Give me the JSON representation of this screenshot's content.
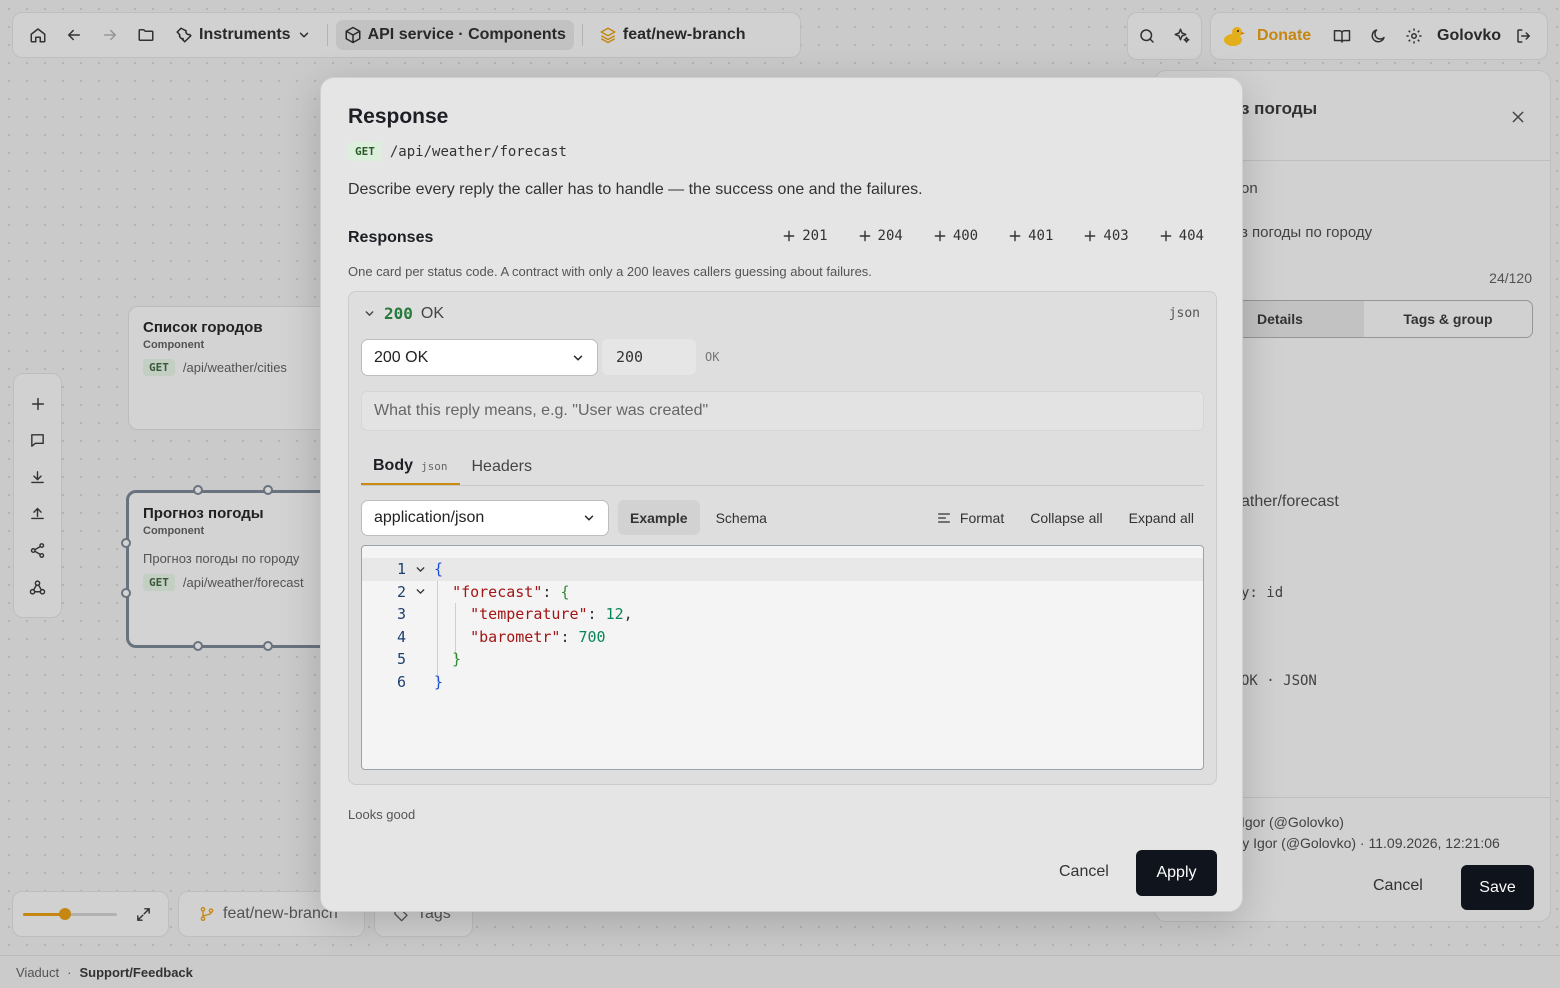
{
  "topbar": {
    "instruments_label": "Instruments",
    "project_label": "API service · Components",
    "branch_label": "feat/new-branch"
  },
  "userbar": {
    "donate_label": "Donate",
    "username": "Golovko"
  },
  "canvas": {
    "node_cities": {
      "title": "Список городов",
      "kind": "Component",
      "method": "GET",
      "path": "/api/weather/cities"
    },
    "node_forecast": {
      "title": "Прогноз погоды",
      "kind": "Component",
      "description": "Прогноз погоды по городу",
      "method": "GET",
      "path": "/api/weather/forecast"
    }
  },
  "bottombar": {
    "zoom_fraction": 0.45,
    "branch_label": "feat/new-branch",
    "tags_label": "Tags"
  },
  "footer": {
    "app_name": "Viaduct",
    "separator": "·",
    "support_label": "Support/Feedback"
  },
  "sidepanel": {
    "title": "з погоды",
    "field_label_partial": "on",
    "description_partial": "з погоды по городу",
    "char_count": "24/120",
    "tabs": [
      "Details",
      "Tags & group"
    ],
    "path_partial": "ather/forecast",
    "key_partial": "y: id",
    "response_partial": "OK · JSON",
    "created_by": "Igor (@Golovko)",
    "updated_by": "ed by Igor (@Golovko) · 11.09.2026, 12:21:06",
    "cancel_label": "Cancel",
    "save_label": "Save"
  },
  "modal": {
    "title": "Response",
    "method": "GET",
    "path": "/api/weather/forecast",
    "description": "Describe every reply the caller has to handle — the success one and the failures.",
    "responses_label": "Responses",
    "add_codes": [
      "201",
      "204",
      "400",
      "401",
      "403",
      "404"
    ],
    "hint": "One card per status code. A contract with only a 200 leaves callers guessing about failures.",
    "card": {
      "code": "200",
      "status_text": "OK",
      "format_badge": "json",
      "status_select": "200 OK",
      "code_value": "200",
      "code_hint": "OK",
      "description_placeholder": "What this reply means, e.g. \"User was created\"",
      "tabs": {
        "body": "Body",
        "body_sub": "json",
        "headers": "Headers"
      },
      "content_type": "application/json",
      "view_modes": [
        "Example",
        "Schema"
      ],
      "format_label": "Format",
      "collapse_label": "Collapse all",
      "expand_label": "Expand all",
      "editor_lines": [
        "1",
        "2",
        "3",
        "4",
        "5",
        "6"
      ],
      "code_tokens": {
        "l1_open": "{",
        "l2_key": "\"forecast\"",
        "l2_colon": ": ",
        "l2_open": "{",
        "l3_key": "\"temperature\"",
        "l3_colon": ": ",
        "l3_val": "12",
        "l3_comma": ",",
        "l4_key": "\"barometr\"",
        "l4_colon": ": ",
        "l4_val": "700",
        "l5_close": "}",
        "l6_close": "}"
      }
    },
    "status_message": "Looks good",
    "cancel_label": "Cancel",
    "apply_label": "Apply"
  }
}
